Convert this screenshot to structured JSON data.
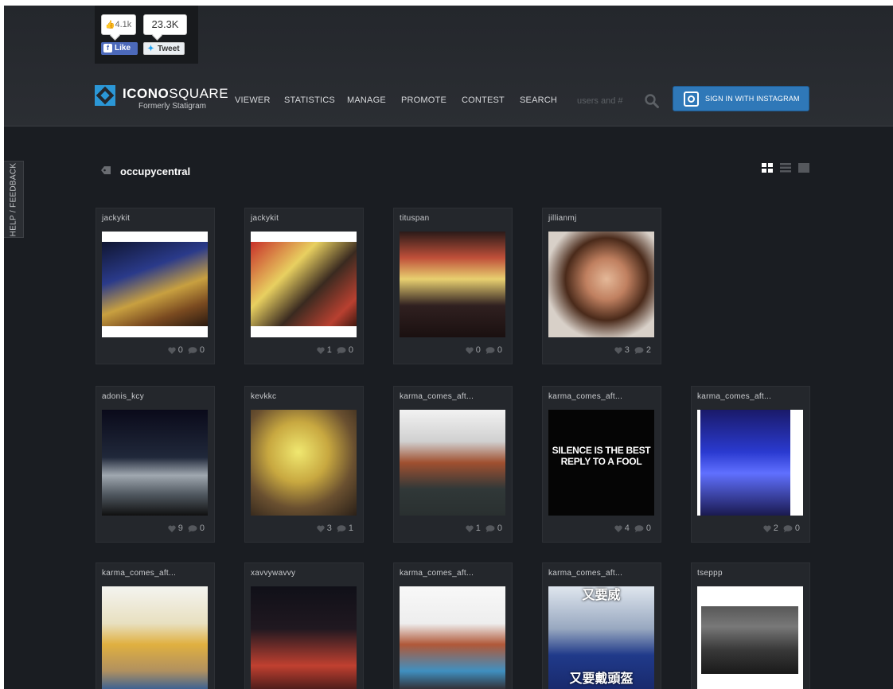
{
  "social": {
    "like_count": "4.1k",
    "like_label": "Like",
    "tweet_count": "23.3K",
    "tweet_label": "Tweet"
  },
  "brand": {
    "name_bold": "ICONO",
    "name_light": "SQUARE",
    "subtitle": "Formerly Statigram"
  },
  "nav": {
    "items": [
      "VIEWER",
      "STATISTICS",
      "MANAGE",
      "PROMOTE",
      "CONTEST",
      "SEARCH"
    ],
    "search_placeholder": "users and #",
    "signin_label": "SIGN IN WITH INSTAGRAM"
  },
  "help_tab": "HELP / FEEDBACK",
  "tag": {
    "title": "occupycentral",
    "view_modes": [
      "grid-view-icon",
      "list-view-icon",
      "single-view-icon"
    ]
  },
  "colors": {
    "page_bg": "#1a1d22",
    "card_bg": "#24272c",
    "accent": "#2f78b8",
    "logo_blue": "#2b97d6"
  },
  "posts": [
    {
      "user": "jackykit",
      "likes": "0",
      "comments": "0"
    },
    {
      "user": "jackykit",
      "likes": "1",
      "comments": "0"
    },
    {
      "user": "tituspan",
      "likes": "0",
      "comments": "0"
    },
    {
      "user": "jillianmj",
      "likes": "3",
      "comments": "2"
    },
    {
      "user": "adonis_kcy",
      "likes": "9",
      "comments": "0"
    },
    {
      "user": "kevkkc",
      "likes": "3",
      "comments": "1"
    },
    {
      "user": "karma_comes_aft...",
      "likes": "1",
      "comments": "0"
    },
    {
      "user": "karma_comes_aft...",
      "likes": "4",
      "comments": "0",
      "poster": [
        "SILENCE IS THE BEST",
        "REPLY TO A FOOL"
      ]
    },
    {
      "user": "karma_comes_aft...",
      "likes": "2",
      "comments": "0"
    },
    {
      "user": "karma_comes_aft...",
      "likes": "",
      "comments": ""
    },
    {
      "user": "xavvywavvy",
      "likes": "",
      "comments": ""
    },
    {
      "user": "karma_comes_aft...",
      "likes": "",
      "comments": ""
    },
    {
      "user": "karma_comes_aft...",
      "likes": "",
      "comments": "",
      "poster": [
        "又要威",
        "又要戴頭盔"
      ]
    },
    {
      "user": "tseppp",
      "likes": "",
      "comments": ""
    }
  ]
}
